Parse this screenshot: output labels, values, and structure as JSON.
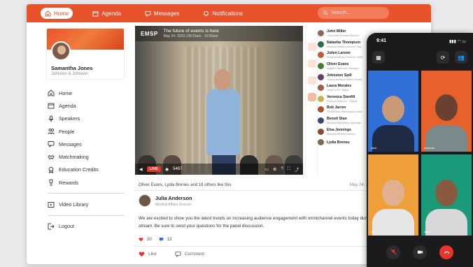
{
  "nav": {
    "items": [
      {
        "label": "Home",
        "icon": "home-icon",
        "active": true
      },
      {
        "label": "Agenda",
        "icon": "calendar-icon",
        "active": false
      },
      {
        "label": "Messages",
        "icon": "chat-icon",
        "active": false
      },
      {
        "label": "Notifications",
        "icon": "bell-icon",
        "active": false
      }
    ],
    "search_placeholder": "Search..."
  },
  "profile": {
    "name": "Samantha Jones",
    "org": "Johnson & Johnson"
  },
  "menu": {
    "items": [
      {
        "label": "Home",
        "icon": "home-icon"
      },
      {
        "label": "Agenda",
        "icon": "calendar-icon"
      },
      {
        "label": "Speakers",
        "icon": "microphone-icon"
      },
      {
        "label": "People",
        "icon": "people-icon"
      },
      {
        "label": "Messages",
        "icon": "chat-icon"
      },
      {
        "label": "Matchmaking",
        "icon": "handshake-icon"
      },
      {
        "label": "Education Credits",
        "icon": "award-icon"
      },
      {
        "label": "Rewards",
        "icon": "trophy-icon"
      }
    ],
    "video_library": "Video Library",
    "logout": "Logout"
  },
  "video": {
    "logo": "EMSP",
    "title": "The future of events is here",
    "date": "May 24, 2023 | 09:15am - 10:00am",
    "live_label": "LIVE",
    "viewer_count": "5487"
  },
  "attendees": [
    {
      "name": "John Miller",
      "role": "Corporate Events Director"
    },
    {
      "name": "Natasha Thompson",
      "role": "Medical Affairs Director, Bay"
    },
    {
      "name": "Julien Larson",
      "role": "Medical Affairs Director, GNE"
    },
    {
      "name": "Oliver Evans",
      "role": "Digital Platforms Manager"
    },
    {
      "name": "Johnston Spill",
      "role": "Global Medical Affairs Direct"
    },
    {
      "name": "Laura Morales",
      "role": "Head of IR, Bayer"
    },
    {
      "name": "Veronica Stenfill",
      "role": "Product Director - Digital"
    },
    {
      "name": "Bob Jarren",
      "role": "TA Medical Information Lead"
    },
    {
      "name": "Benoit Stan",
      "role": "Medical Marketing Manager"
    },
    {
      "name": "Elsa Jennings",
      "role": "Medical Affairs Director"
    },
    {
      "name": "Lydia Breneu",
      "role": ""
    }
  ],
  "post": {
    "likes_line": "Oliver Evans, Lydia Breneu and 18 others like this",
    "date": "May 24, 2",
    "author": "Julia Anderson",
    "author_role": "Medical Affairs Director",
    "text": "We are excited to show you the latest trends on increasing audience engagement with omnichannel events today during the live stream. Be sure to send your questions for the panel discussion.",
    "like_count": "20",
    "comment_count": "13",
    "like_label": "Like",
    "comment_label": "Comment"
  },
  "phone": {
    "time": "9:41",
    "tiles": [
      "Jack",
      "Amanda",
      "Ann",
      "Mike"
    ]
  },
  "colors": {
    "brand": "#e8532b",
    "live": "#e8352b"
  }
}
